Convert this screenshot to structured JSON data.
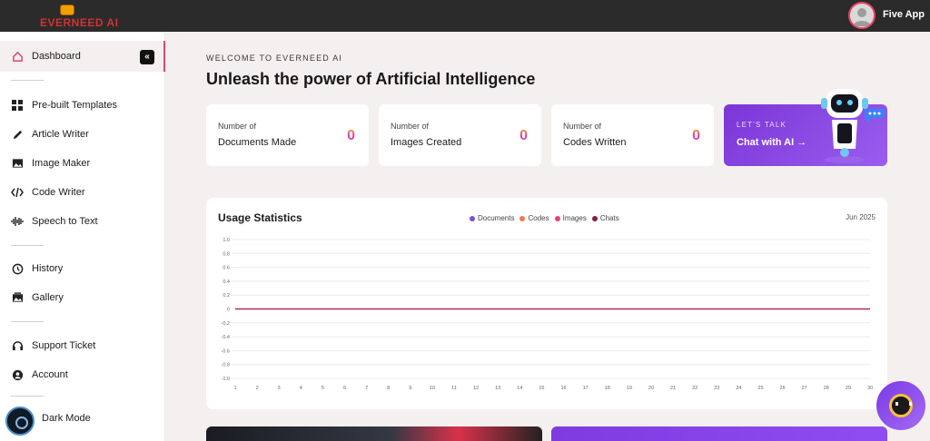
{
  "app": {
    "logo_text": "EVERNEED AI",
    "user_name": "Five App"
  },
  "sidebar": {
    "active": "Dashboard",
    "items": [
      {
        "label": "Dashboard",
        "icon": "home-icon"
      },
      {
        "label": "Pre-built Templates",
        "icon": "grid-icon"
      },
      {
        "label": "Article Writer",
        "icon": "pen-icon"
      },
      {
        "label": "Image Maker",
        "icon": "image-icon"
      },
      {
        "label": "Code Writer",
        "icon": "code-icon"
      },
      {
        "label": "Speech to Text",
        "icon": "waveform-icon"
      },
      {
        "label": "History",
        "icon": "history-icon"
      },
      {
        "label": "Gallery",
        "icon": "gallery-icon"
      },
      {
        "label": "Support Ticket",
        "icon": "headset-icon"
      },
      {
        "label": "Account",
        "icon": "user-icon"
      }
    ],
    "dark_mode_label": "Dark Mode",
    "collapse_glyph": "«"
  },
  "main": {
    "welcome": "WELCOME TO EVERNEED AI",
    "headline": "Unleash the power of Artificial Intelligence",
    "stats": [
      {
        "small": "Number of",
        "big": "Documents Made",
        "value": "0"
      },
      {
        "small": "Number of",
        "big": "Images Created",
        "value": "0"
      },
      {
        "small": "Number of",
        "big": "Codes Written",
        "value": "0"
      }
    ],
    "chat_card": {
      "kicker": "LET'S TALK",
      "title": "Chat with AI  →"
    }
  },
  "usage": {
    "title": "Usage Statistics",
    "month": "Jun 2025",
    "legend": [
      {
        "name": "Documents",
        "color": "#7b4fd6"
      },
      {
        "name": "Codes",
        "color": "#f07a4a"
      },
      {
        "name": "Images",
        "color": "#e8407a"
      },
      {
        "name": "Chats",
        "color": "#8a1c3a"
      }
    ]
  },
  "chart_data": {
    "type": "line",
    "x": [
      1,
      2,
      3,
      4,
      5,
      6,
      7,
      8,
      9,
      10,
      11,
      12,
      13,
      14,
      15,
      16,
      17,
      18,
      19,
      20,
      21,
      22,
      23,
      24,
      25,
      26,
      27,
      28,
      29,
      30
    ],
    "y_ticks": [
      "1.0",
      "0.8",
      "0.6",
      "0.4",
      "0.2",
      "0",
      "-0.2",
      "-0.4",
      "-0.6",
      "-0.8",
      "-1.0"
    ],
    "ylim": [
      -1.0,
      1.0
    ],
    "grid": true,
    "series": [
      {
        "name": "Documents",
        "values": [
          0,
          0,
          0,
          0,
          0,
          0,
          0,
          0,
          0,
          0,
          0,
          0,
          0,
          0,
          0,
          0,
          0,
          0,
          0,
          0,
          0,
          0,
          0,
          0,
          0,
          0,
          0,
          0,
          0,
          0
        ]
      },
      {
        "name": "Codes",
        "values": [
          0,
          0,
          0,
          0,
          0,
          0,
          0,
          0,
          0,
          0,
          0,
          0,
          0,
          0,
          0,
          0,
          0,
          0,
          0,
          0,
          0,
          0,
          0,
          0,
          0,
          0,
          0,
          0,
          0,
          0
        ]
      },
      {
        "name": "Images",
        "values": [
          0,
          0,
          0,
          0,
          0,
          0,
          0,
          0,
          0,
          0,
          0,
          0,
          0,
          0,
          0,
          0,
          0,
          0,
          0,
          0,
          0,
          0,
          0,
          0,
          0,
          0,
          0,
          0,
          0,
          0
        ]
      },
      {
        "name": "Chats",
        "values": [
          0,
          0,
          0,
          0,
          0,
          0,
          0,
          0,
          0,
          0,
          0,
          0,
          0,
          0,
          0,
          0,
          0,
          0,
          0,
          0,
          0,
          0,
          0,
          0,
          0,
          0,
          0,
          0,
          0,
          0
        ]
      }
    ]
  }
}
